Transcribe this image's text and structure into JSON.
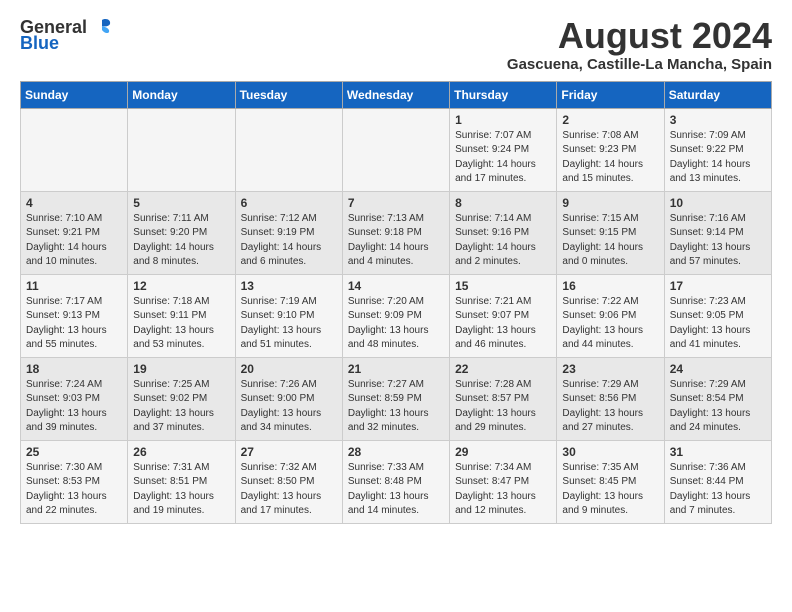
{
  "logo": {
    "text_general": "General",
    "text_blue": "Blue"
  },
  "title": "August 2024",
  "subtitle": "Gascuena, Castille-La Mancha, Spain",
  "weekdays": [
    "Sunday",
    "Monday",
    "Tuesday",
    "Wednesday",
    "Thursday",
    "Friday",
    "Saturday"
  ],
  "weeks": [
    [
      {
        "day": "",
        "info": ""
      },
      {
        "day": "",
        "info": ""
      },
      {
        "day": "",
        "info": ""
      },
      {
        "day": "",
        "info": ""
      },
      {
        "day": "1",
        "info": "Sunrise: 7:07 AM\nSunset: 9:24 PM\nDaylight: 14 hours\nand 17 minutes."
      },
      {
        "day": "2",
        "info": "Sunrise: 7:08 AM\nSunset: 9:23 PM\nDaylight: 14 hours\nand 15 minutes."
      },
      {
        "day": "3",
        "info": "Sunrise: 7:09 AM\nSunset: 9:22 PM\nDaylight: 14 hours\nand 13 minutes."
      }
    ],
    [
      {
        "day": "4",
        "info": "Sunrise: 7:10 AM\nSunset: 9:21 PM\nDaylight: 14 hours\nand 10 minutes."
      },
      {
        "day": "5",
        "info": "Sunrise: 7:11 AM\nSunset: 9:20 PM\nDaylight: 14 hours\nand 8 minutes."
      },
      {
        "day": "6",
        "info": "Sunrise: 7:12 AM\nSunset: 9:19 PM\nDaylight: 14 hours\nand 6 minutes."
      },
      {
        "day": "7",
        "info": "Sunrise: 7:13 AM\nSunset: 9:18 PM\nDaylight: 14 hours\nand 4 minutes."
      },
      {
        "day": "8",
        "info": "Sunrise: 7:14 AM\nSunset: 9:16 PM\nDaylight: 14 hours\nand 2 minutes."
      },
      {
        "day": "9",
        "info": "Sunrise: 7:15 AM\nSunset: 9:15 PM\nDaylight: 14 hours\nand 0 minutes."
      },
      {
        "day": "10",
        "info": "Sunrise: 7:16 AM\nSunset: 9:14 PM\nDaylight: 13 hours\nand 57 minutes."
      }
    ],
    [
      {
        "day": "11",
        "info": "Sunrise: 7:17 AM\nSunset: 9:13 PM\nDaylight: 13 hours\nand 55 minutes."
      },
      {
        "day": "12",
        "info": "Sunrise: 7:18 AM\nSunset: 9:11 PM\nDaylight: 13 hours\nand 53 minutes."
      },
      {
        "day": "13",
        "info": "Sunrise: 7:19 AM\nSunset: 9:10 PM\nDaylight: 13 hours\nand 51 minutes."
      },
      {
        "day": "14",
        "info": "Sunrise: 7:20 AM\nSunset: 9:09 PM\nDaylight: 13 hours\nand 48 minutes."
      },
      {
        "day": "15",
        "info": "Sunrise: 7:21 AM\nSunset: 9:07 PM\nDaylight: 13 hours\nand 46 minutes."
      },
      {
        "day": "16",
        "info": "Sunrise: 7:22 AM\nSunset: 9:06 PM\nDaylight: 13 hours\nand 44 minutes."
      },
      {
        "day": "17",
        "info": "Sunrise: 7:23 AM\nSunset: 9:05 PM\nDaylight: 13 hours\nand 41 minutes."
      }
    ],
    [
      {
        "day": "18",
        "info": "Sunrise: 7:24 AM\nSunset: 9:03 PM\nDaylight: 13 hours\nand 39 minutes."
      },
      {
        "day": "19",
        "info": "Sunrise: 7:25 AM\nSunset: 9:02 PM\nDaylight: 13 hours\nand 37 minutes."
      },
      {
        "day": "20",
        "info": "Sunrise: 7:26 AM\nSunset: 9:00 PM\nDaylight: 13 hours\nand 34 minutes."
      },
      {
        "day": "21",
        "info": "Sunrise: 7:27 AM\nSunset: 8:59 PM\nDaylight: 13 hours\nand 32 minutes."
      },
      {
        "day": "22",
        "info": "Sunrise: 7:28 AM\nSunset: 8:57 PM\nDaylight: 13 hours\nand 29 minutes."
      },
      {
        "day": "23",
        "info": "Sunrise: 7:29 AM\nSunset: 8:56 PM\nDaylight: 13 hours\nand 27 minutes."
      },
      {
        "day": "24",
        "info": "Sunrise: 7:29 AM\nSunset: 8:54 PM\nDaylight: 13 hours\nand 24 minutes."
      }
    ],
    [
      {
        "day": "25",
        "info": "Sunrise: 7:30 AM\nSunset: 8:53 PM\nDaylight: 13 hours\nand 22 minutes."
      },
      {
        "day": "26",
        "info": "Sunrise: 7:31 AM\nSunset: 8:51 PM\nDaylight: 13 hours\nand 19 minutes."
      },
      {
        "day": "27",
        "info": "Sunrise: 7:32 AM\nSunset: 8:50 PM\nDaylight: 13 hours\nand 17 minutes."
      },
      {
        "day": "28",
        "info": "Sunrise: 7:33 AM\nSunset: 8:48 PM\nDaylight: 13 hours\nand 14 minutes."
      },
      {
        "day": "29",
        "info": "Sunrise: 7:34 AM\nSunset: 8:47 PM\nDaylight: 13 hours\nand 12 minutes."
      },
      {
        "day": "30",
        "info": "Sunrise: 7:35 AM\nSunset: 8:45 PM\nDaylight: 13 hours\nand 9 minutes."
      },
      {
        "day": "31",
        "info": "Sunrise: 7:36 AM\nSunset: 8:44 PM\nDaylight: 13 hours\nand 7 minutes."
      }
    ]
  ]
}
